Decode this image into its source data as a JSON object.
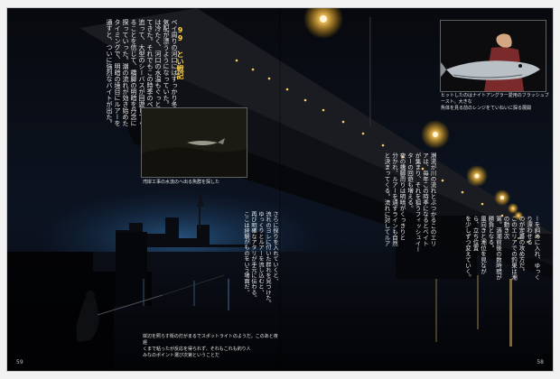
{
  "magazine_spread": {
    "left_page": {
      "heading": "99 とい戦記",
      "inset_caption": "湾岸工事の水流のへ出る魚群を探した",
      "bottom_caption_lines": [
        "岸辺を照らす街の灯がまるでスポットライトのようだ。このあと夜遅",
        "くまで粘ったが反応を得られず、それもこれも釣り人",
        "みなのポイント選び次第ということだ"
      ],
      "columns": [
        "ベイ周りの河口にはすっかり冬の",
        "気配が漂うようになっていた。夜風",
        "は冷たく、河口の水温もぐっと下がっ",
        "てきた。それでもこの時季のベイトを",
        "追って、大型のシーバスが回遊してく",
        "ることを信じて、橋脚の明暗を丹念に",
        "探っていった。潮の流れが効き始めた",
        "タイミングで、明暗の境目にルアーを",
        "通すと、ついに強烈なバイトが出た。",
        "さらに探りを入れていくと、",
        "流れのヨレに付いた群れを見つけた。",
        "ゆっくりとルアーを流し込むと、",
        "再び明確なアタリが手元に伝わる。",
        "ここは経験がものをいう場面だ。"
      ]
    },
    "right_page": {
      "photo_caption_lines": [
        "ヒットしたのはナイトアングラー愛用のフラッシュブースト。大きな",
        "魚体を見る前のレンジをていねいに探る展開"
      ],
      "columns": [
        "潮流が川の流れとぶつかるこのエリ",
        "アは、毎年この時季になるとベイト",
        "が集まり、それを狙うフィッシュイー",
        "ターの回遊も増える。",
        "夜の橋脚周りは明暗がくっきりと",
        "分かれ、ルアーを通すラインも自然",
        "と決まってくる。流れに対してルア",
        "ーを斜めに入れ、ゆっくり漂わせる",
        "のが定番の攻め方だ。",
        "このエリアでの釣果は潮の動き次",
        "第。満潮前後の数時間が勝負となる。",
        "風向きと潮位を見ながら、立ち位置",
        "を少しずつ変えていく。"
      ]
    },
    "page_numbers": {
      "left": "59",
      "right": "58"
    }
  }
}
